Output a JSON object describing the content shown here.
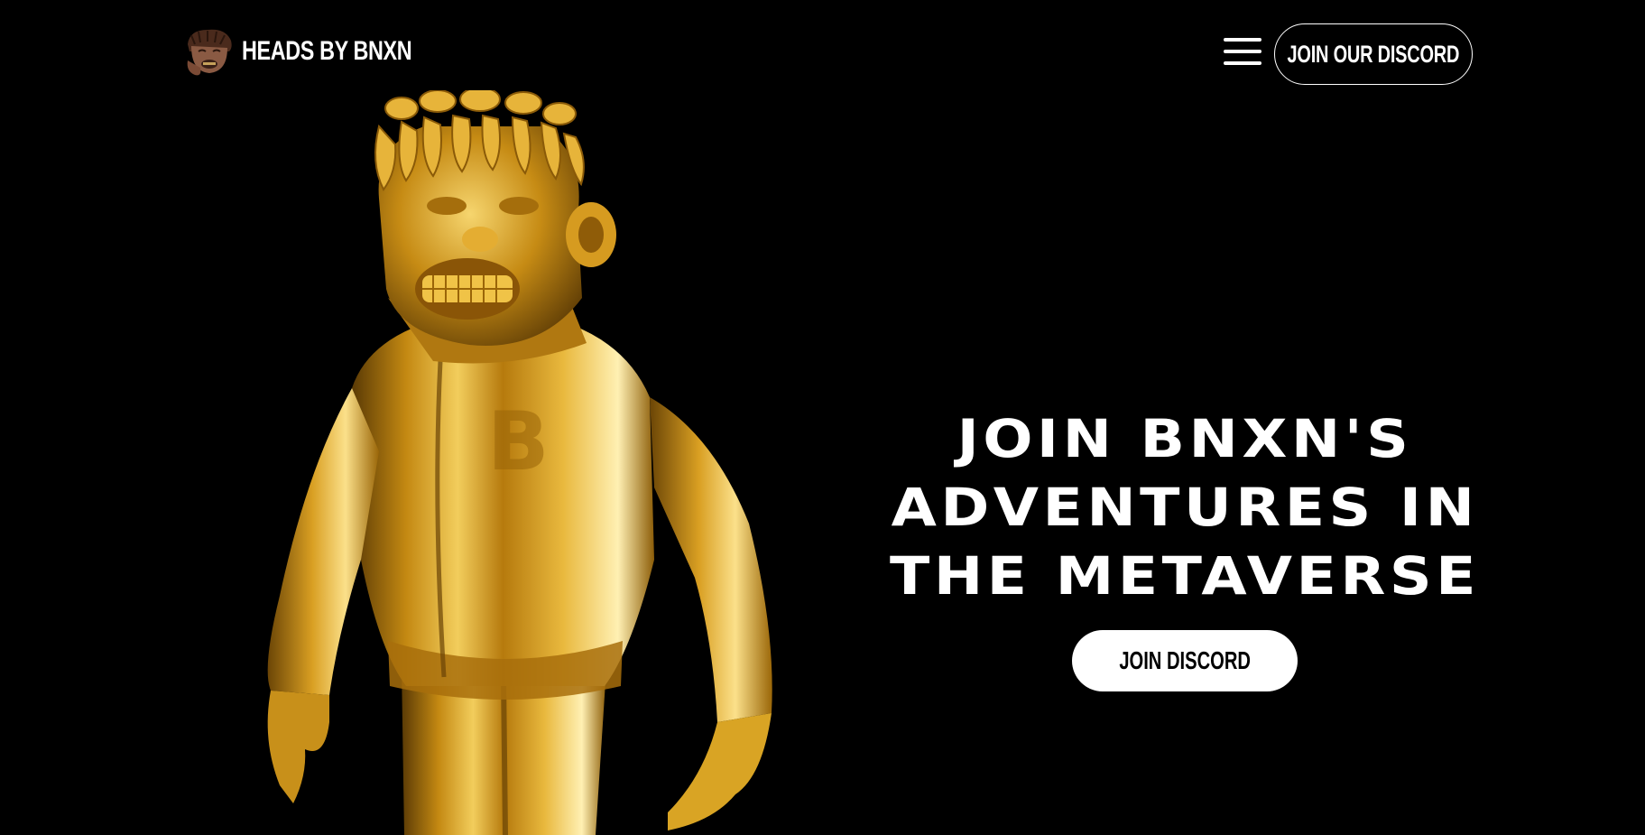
{
  "header": {
    "brand_name": "HEADS BY BNXN",
    "menu_icon": "hamburger-menu-icon",
    "cta_label": "JOIN OUR DISCORD"
  },
  "hero": {
    "heading_lines": [
      "JOIN BNXN'S",
      "ADVENTURES IN",
      "THE METAVERSE"
    ],
    "cta_label": "JOIN DISCORD",
    "figure": "gold-character-figure"
  },
  "colors": {
    "background": "#000000",
    "text": "#ffffff",
    "primary_button_bg": "#ffffff",
    "primary_button_text": "#000000",
    "gold": "#d9a21b"
  }
}
